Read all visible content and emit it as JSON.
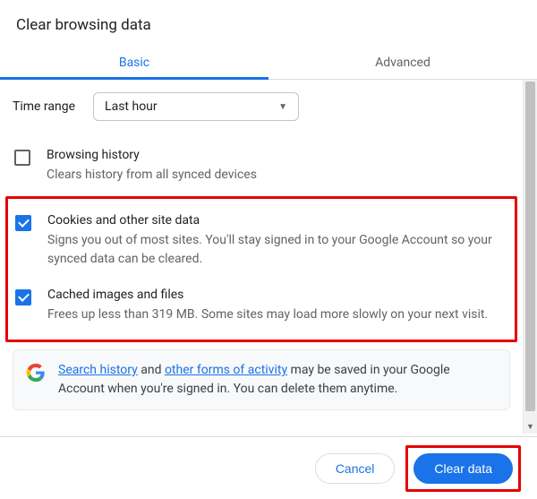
{
  "dialog": {
    "title": "Clear browsing data"
  },
  "tabs": {
    "basic": "Basic",
    "advanced": "Advanced"
  },
  "time_range": {
    "label": "Time range",
    "selected": "Last hour"
  },
  "items": {
    "browsing_history": {
      "checked": false,
      "title": "Browsing history",
      "desc": "Clears history from all synced devices"
    },
    "cookies": {
      "checked": true,
      "title": "Cookies and other site data",
      "desc": "Signs you out of most sites. You'll stay signed in to your Google Account so your synced data can be cleared."
    },
    "cache": {
      "checked": true,
      "title": "Cached images and files",
      "desc": "Frees up less than 319 MB. Some sites may load more slowly on your next visit."
    }
  },
  "info": {
    "link1": "Search history",
    "mid1": " and ",
    "link2": "other forms of activity",
    "rest": " may be saved in your Google Account when you're signed in. You can delete them anytime."
  },
  "footer": {
    "cancel": "Cancel",
    "clear": "Clear data"
  }
}
